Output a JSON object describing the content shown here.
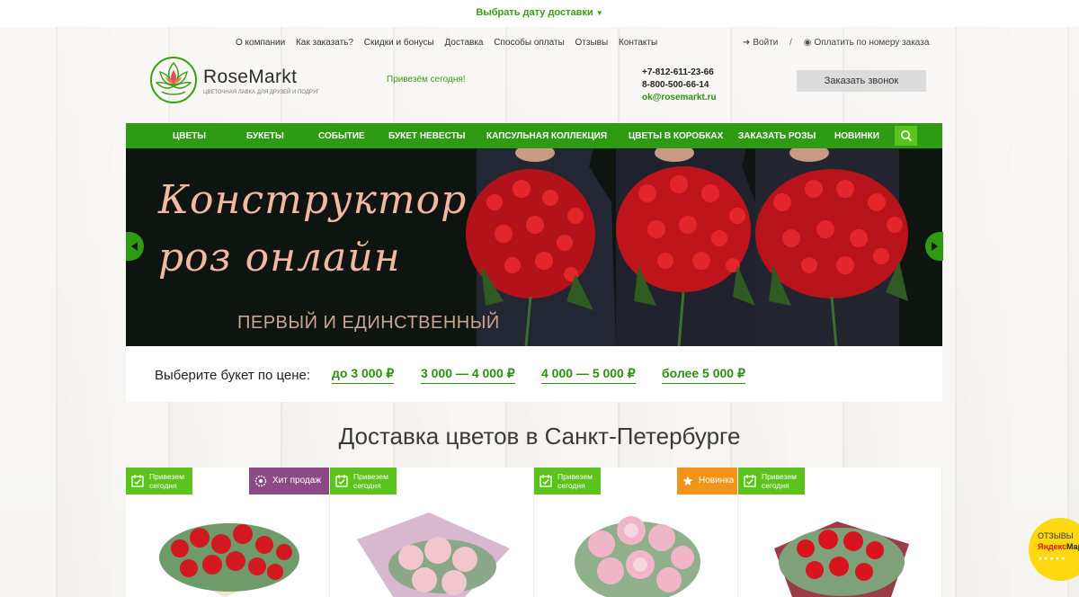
{
  "topbar": {
    "delivery_date": "Выбрать дату доставки"
  },
  "topnav": {
    "items": [
      "О компании",
      "Как заказать?",
      "Скидки и бонусы",
      "Доставка",
      "Способы оплаты",
      "Отзывы",
      "Контакты"
    ]
  },
  "account": {
    "login": "Войти",
    "separator": "/",
    "pay_by_order": "Оплатить по номеру заказа"
  },
  "logo": {
    "name": "RoseMarkt",
    "tagline": "ЦВЕТОЧНАЯ ЛАВКА ДЛЯ ДРУЗЕЙ И ПОДРУГ"
  },
  "promo_today": "Привезём сегодня!",
  "contacts": {
    "phone1": "+7-812-611-23-66",
    "phone2": "8-800-500-66-14",
    "email": "ok@rosemarkt.ru"
  },
  "callback_label": "Заказать звонок",
  "mainnav": {
    "items": [
      "ЦВЕТЫ",
      "БУКЕТЫ",
      "СОБЫТИЕ",
      "БУКЕТ НЕВЕСТЫ",
      "КАПСУЛЬНАЯ КОЛЛЕКЦИЯ",
      "ЦВЕТЫ В КОРОБКАХ",
      "ЗАКАЗАТЬ РОЗЫ",
      "НОВИНКИ"
    ]
  },
  "banner": {
    "headline_line1": "Конструктор",
    "headline_line2": "роз онлайн",
    "subtitle": "ПЕРВЫЙ И ЕДИНСТВЕННЫЙ"
  },
  "pricebar": {
    "label": "Выберите букет по цене:",
    "options": [
      "до 3 000 ₽",
      "3 000 — 4 000 ₽",
      "4 000 — 5 000 ₽",
      "более 5 000 ₽"
    ]
  },
  "section_title": "Доставка цветов в Санкт-Петербурге",
  "badges": {
    "today": "Привезем сегодня",
    "bestseller": "Хит продаж",
    "new": "Новинка"
  },
  "yandex": {
    "line1": "ОТЗЫВЫ",
    "brand_y": "Яндекс",
    "brand_m": "Маркет"
  },
  "colors": {
    "accent": "#2e9b12",
    "accent_light": "#5cc21c",
    "purple": "#8b4a86",
    "orange": "#f29418",
    "yellow": "#ffd90f"
  }
}
